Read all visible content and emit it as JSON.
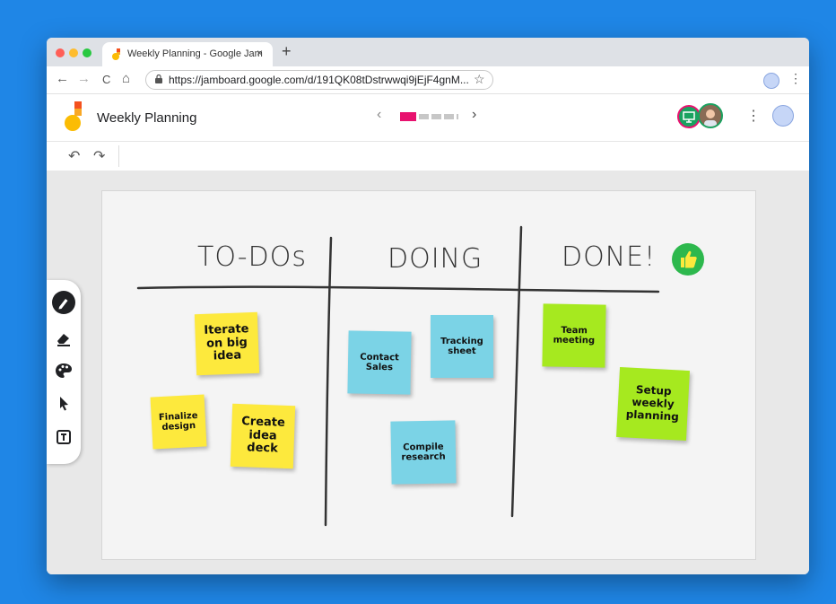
{
  "browser": {
    "tab_title": "Weekly Planning - Google Jam",
    "tab_close": "×",
    "new_tab": "+",
    "url": "https://jamboard.google.com/d/191QK08tDstrwwqi9jEjF4gnM...",
    "nav": {
      "back": "←",
      "forward": "→",
      "reload": "C",
      "home": "⌂"
    },
    "bookmark_icon": "star-icon",
    "menu_glyph": "⋮"
  },
  "app": {
    "title": "Weekly Planning",
    "frame_prev": "‹",
    "frame_next": "›",
    "menu_glyph": "⋮",
    "accent_color": "#e8126f"
  },
  "editbar": {
    "undo": "↶",
    "redo": "↷"
  },
  "board": {
    "columns": [
      {
        "heading": "TO-DOs"
      },
      {
        "heading": "DOING"
      },
      {
        "heading": "DONE!"
      }
    ],
    "notes": [
      {
        "text": "Iterate on big idea",
        "color": "yellow"
      },
      {
        "text": "Finalize design",
        "color": "yellow"
      },
      {
        "text": "Create idea deck",
        "color": "yellow"
      },
      {
        "text": "Contact Sales",
        "color": "blue"
      },
      {
        "text": "Tracking sheet",
        "color": "blue"
      },
      {
        "text": "Compile research",
        "color": "blue"
      },
      {
        "text": "Team meeting",
        "color": "green"
      },
      {
        "text": "Setup weekly planning",
        "color": "green"
      }
    ],
    "colors": {
      "yellow": "#fde93d",
      "blue": "#7bd3e6",
      "green": "#a6e91f"
    }
  },
  "tools": [
    "pen-icon",
    "eraser-icon",
    "palette-icon",
    "select-arrow-icon",
    "text-box-icon"
  ]
}
